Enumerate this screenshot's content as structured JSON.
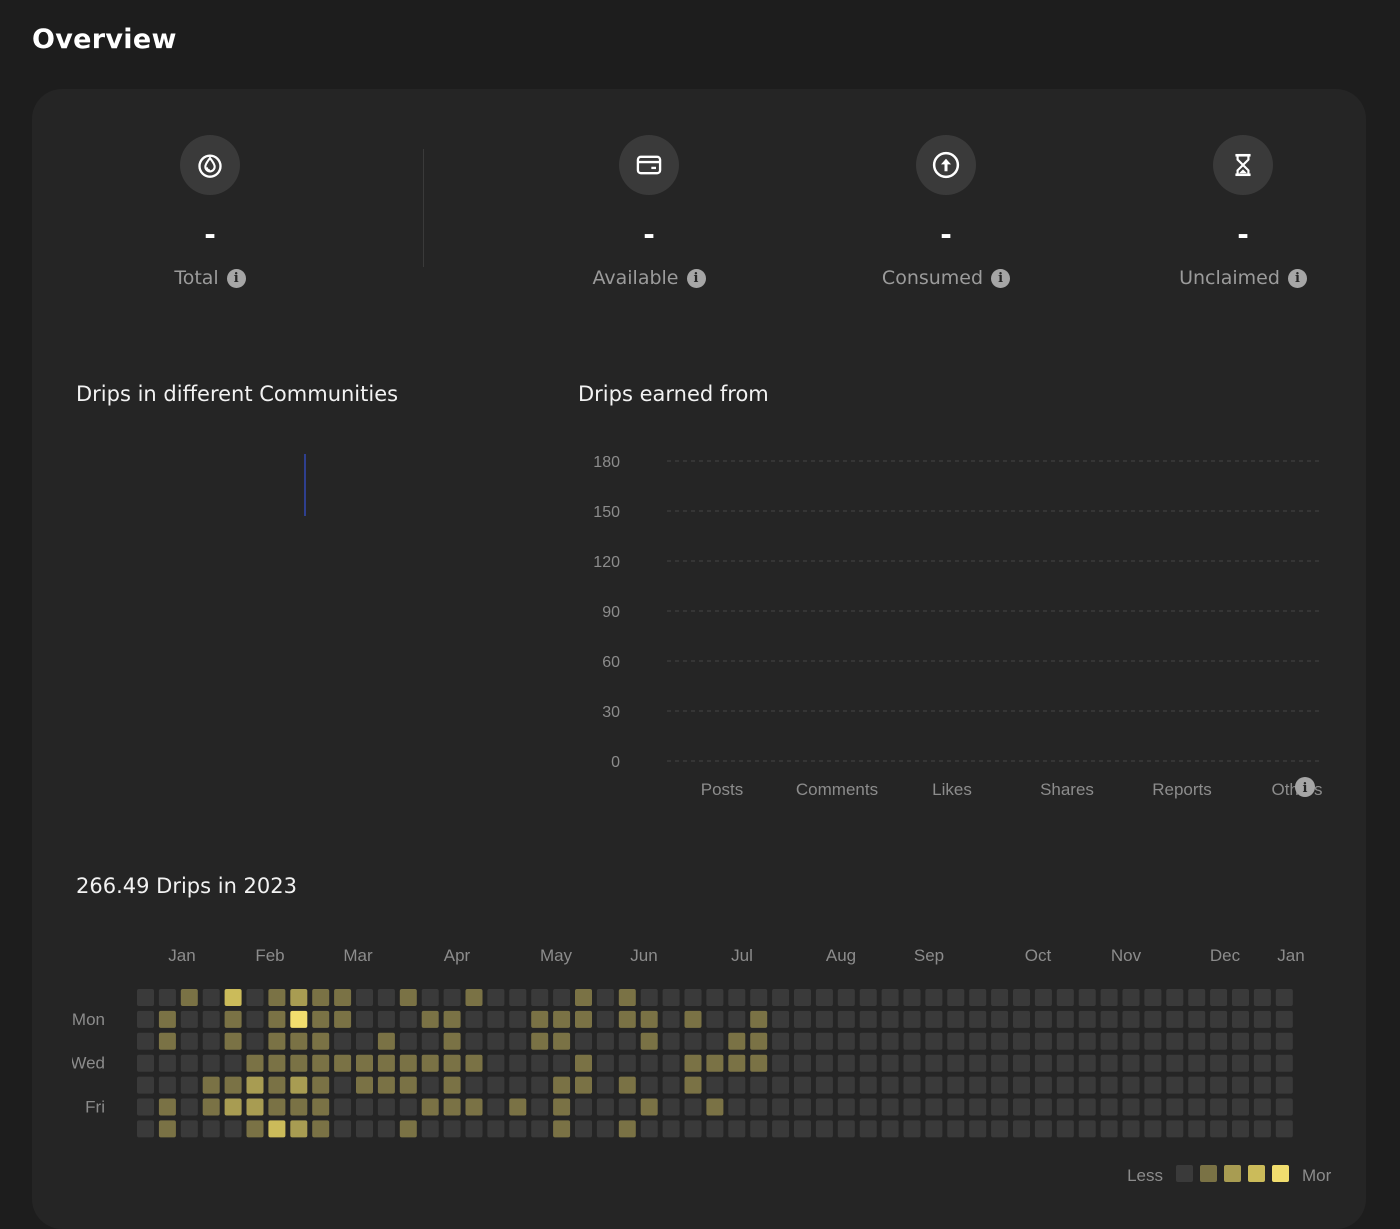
{
  "page": {
    "title": "Overview"
  },
  "stats": [
    {
      "label": "Total",
      "value": "-",
      "icon": "drop-icon"
    },
    {
      "label": "Available",
      "value": "-",
      "icon": "wallet-icon"
    },
    {
      "label": "Consumed",
      "value": "-",
      "icon": "arrow-up-circle-icon"
    },
    {
      "label": "Unclaimed",
      "value": "-",
      "icon": "hourglass-icon"
    }
  ],
  "communities": {
    "title": "Drips in different Communities"
  },
  "earned": {
    "title": "Drips earned from"
  },
  "chart_data": {
    "type": "bar",
    "title": "Drips earned from",
    "categories": [
      "Posts",
      "Comments",
      "Likes",
      "Shares",
      "Reports",
      "Others"
    ],
    "values": [
      0,
      0,
      0,
      0,
      0,
      0
    ],
    "yticks": [
      0,
      30,
      60,
      90,
      120,
      150,
      180
    ],
    "ylim": [
      0,
      180
    ],
    "grid": true
  },
  "heatmap": {
    "title": "266.49 Drips in 2023",
    "months": [
      "Jan",
      "Feb",
      "Mar",
      "Apr",
      "May",
      "Jun",
      "Jul",
      "Aug",
      "Sep",
      "Oct",
      "Nov",
      "Dec",
      "Jan"
    ],
    "days": [
      "Mon",
      "Wed",
      "Fri"
    ],
    "legend_less": "Less",
    "legend_more": "More",
    "colors": [
      "#3a3a3a",
      "#7a7245",
      "#a89c52",
      "#cbbb5a",
      "#f1dd6e"
    ],
    "weeks": [
      [
        0,
        0,
        0,
        0,
        0,
        0,
        0
      ],
      [
        0,
        1,
        1,
        0,
        0,
        1,
        1
      ],
      [
        1,
        0,
        0,
        0,
        0,
        0,
        0
      ],
      [
        0,
        0,
        0,
        0,
        1,
        1,
        0
      ],
      [
        3,
        1,
        1,
        0,
        1,
        2,
        0
      ],
      [
        0,
        0,
        0,
        1,
        2,
        2,
        1
      ],
      [
        1,
        1,
        1,
        1,
        1,
        1,
        3
      ],
      [
        2,
        4,
        1,
        1,
        2,
        1,
        2
      ],
      [
        1,
        1,
        1,
        1,
        1,
        1,
        1
      ],
      [
        1,
        1,
        0,
        1,
        0,
        0,
        0
      ],
      [
        0,
        0,
        0,
        1,
        1,
        0,
        0
      ],
      [
        0,
        0,
        1,
        1,
        1,
        0,
        0
      ],
      [
        1,
        0,
        0,
        1,
        1,
        0,
        1
      ],
      [
        0,
        1,
        0,
        1,
        0,
        1,
        0
      ],
      [
        0,
        1,
        1,
        1,
        1,
        1,
        0
      ],
      [
        1,
        0,
        0,
        1,
        0,
        1,
        0
      ],
      [
        0,
        0,
        0,
        0,
        0,
        0,
        0
      ],
      [
        0,
        0,
        0,
        0,
        0,
        1,
        0
      ],
      [
        0,
        1,
        1,
        0,
        0,
        0,
        0
      ],
      [
        0,
        1,
        1,
        0,
        1,
        1,
        1
      ],
      [
        1,
        1,
        0,
        1,
        1,
        0,
        0
      ],
      [
        0,
        0,
        0,
        0,
        0,
        0,
        0
      ],
      [
        1,
        1,
        0,
        0,
        1,
        0,
        1
      ],
      [
        0,
        1,
        1,
        0,
        0,
        1,
        0
      ],
      [
        0,
        0,
        0,
        0,
        0,
        0,
        0
      ],
      [
        0,
        1,
        0,
        1,
        1,
        0,
        0
      ],
      [
        0,
        0,
        0,
        1,
        0,
        1,
        0
      ],
      [
        0,
        0,
        1,
        1,
        0,
        0,
        0
      ],
      [
        0,
        1,
        1,
        1,
        0,
        0,
        0
      ],
      [
        0,
        0,
        0,
        0,
        0,
        0,
        0
      ],
      [
        0,
        0,
        0,
        0,
        0,
        0,
        0
      ],
      [
        0,
        0,
        0,
        0,
        0,
        0,
        0
      ],
      [
        0,
        0,
        0,
        0,
        0,
        0,
        0
      ],
      [
        0,
        0,
        0,
        0,
        0,
        0,
        0
      ],
      [
        0,
        0,
        0,
        0,
        0,
        0,
        0
      ],
      [
        0,
        0,
        0,
        0,
        0,
        0,
        0
      ],
      [
        0,
        0,
        0,
        0,
        0,
        0,
        0
      ],
      [
        0,
        0,
        0,
        0,
        0,
        0,
        0
      ],
      [
        0,
        0,
        0,
        0,
        0,
        0,
        0
      ],
      [
        0,
        0,
        0,
        0,
        0,
        0,
        0
      ],
      [
        0,
        0,
        0,
        0,
        0,
        0,
        0
      ],
      [
        0,
        0,
        0,
        0,
        0,
        0,
        0
      ],
      [
        0,
        0,
        0,
        0,
        0,
        0,
        0
      ],
      [
        0,
        0,
        0,
        0,
        0,
        0,
        0
      ],
      [
        0,
        0,
        0,
        0,
        0,
        0,
        0
      ],
      [
        0,
        0,
        0,
        0,
        0,
        0,
        0
      ],
      [
        0,
        0,
        0,
        0,
        0,
        0,
        0
      ],
      [
        0,
        0,
        0,
        0,
        0,
        0,
        0
      ],
      [
        0,
        0,
        0,
        0,
        0,
        0,
        0
      ],
      [
        0,
        0,
        0,
        0,
        0,
        0,
        0
      ],
      [
        0,
        0,
        0,
        0,
        0,
        0,
        0
      ],
      [
        0,
        0,
        0,
        0,
        0,
        0,
        0
      ],
      [
        0,
        0,
        0,
        0,
        0,
        0,
        0
      ]
    ]
  }
}
